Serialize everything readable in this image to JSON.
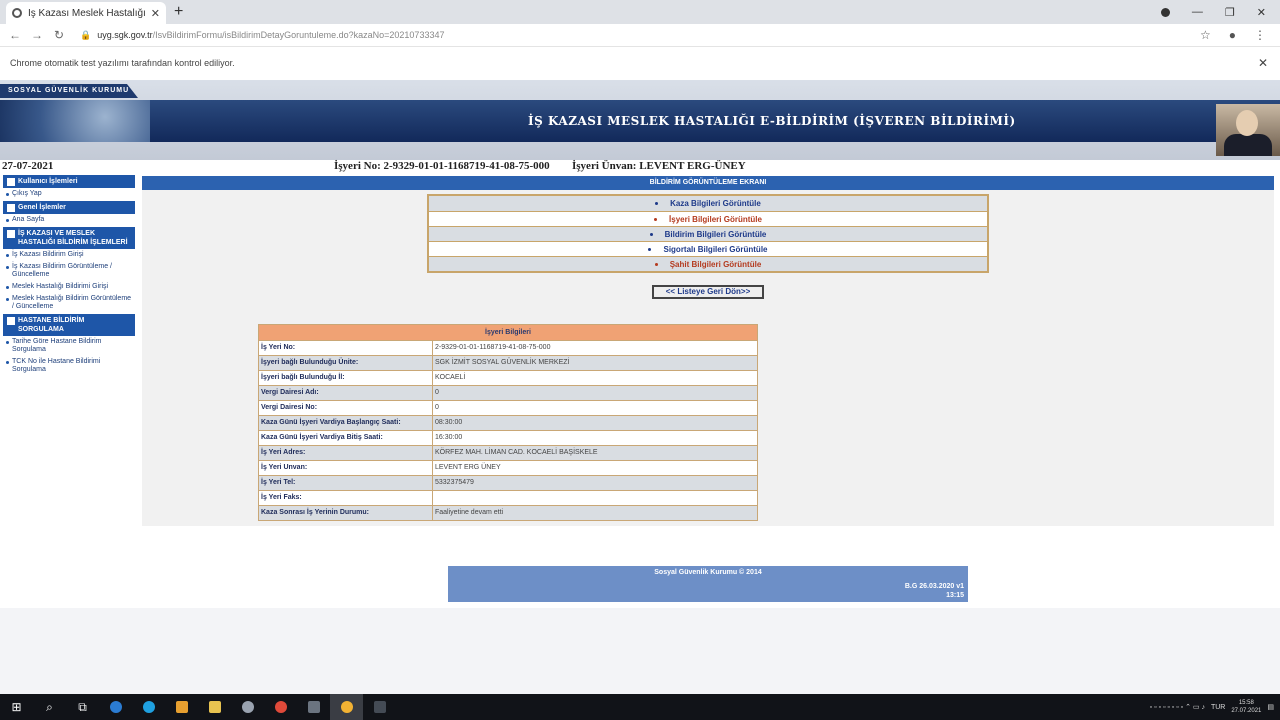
{
  "browser": {
    "tab_title": "İş Kazası Meslek Hastalığı Bildirimi",
    "new_tab": "+",
    "url_host": "uyg.sgk.gov.tr",
    "url_path": "/IsvBildirimFormu/isBildirimDetayGoruntuleme.do?kazaNo=20210733347",
    "infobar_text": "Chrome otomatik test yazılımı tarafından kontrol ediliyor."
  },
  "banner": {
    "logo_text": "SOSYAL GÜVENLİK KURUMU",
    "title": "İŞ KAZASI MESLEK HASTALIĞI E-BİLDİRİM (İŞVEREN BİLDİRİMİ)"
  },
  "info": {
    "date": "27-07-2021",
    "isyeri_no": "İşyeri No: 2-9329-01-01-1168719-41-08-75-000",
    "isyeri_unvan": "İşyeri Ünvan: LEVENT ERG-ÜNEY"
  },
  "sidebar": {
    "sections": [
      {
        "title": "Kullanıcı İşlemleri",
        "items": [
          "Çıkış Yap"
        ]
      },
      {
        "title": "Genel İşlemler",
        "items": [
          "Ana Sayfa"
        ]
      },
      {
        "title": "İŞ KAZASI VE MESLEK HASTALIĞI BİLDİRİM İŞLEMLERİ",
        "items": [
          "İş Kazası Bildirim Girişi",
          "İş Kazası Bildirim Görüntüleme / Güncelleme",
          "Meslek Hastalığı Bildirimi Girişi",
          "Meslek Hastalığı Bildirim Görüntüleme / Güncelleme"
        ]
      },
      {
        "title": "HASTANE BİLDİRİM SORGULAMA",
        "items": [
          "Tarihe Göre Hastane Bildirim Sorgulama",
          "TCK No ile Hastane Bildirimi Sorgulama"
        ]
      }
    ]
  },
  "main": {
    "screen_title": "BİLDİRİM GÖRÜNTÜLEME EKRANI",
    "menu": [
      "Kaza Bilgileri Görüntüle",
      "İşyeri Bilgileri Görüntüle",
      "Bildirim Bilgileri Görüntüle",
      "Sigortalı Bilgileri Görüntüle",
      "Şahit Bilgileri Görüntüle"
    ],
    "back_button": "<< Listeye Geri Dön>>",
    "detail_title": "İşyeri Bilgileri",
    "rows": [
      {
        "label": "İş Yeri No:",
        "value": "2-9329-01-01-1168719-41-08-75-000"
      },
      {
        "label": "İşyeri bağlı Bulunduğu Ünite:",
        "value": "SGK İZMİT SOSYAL GÜVENLİK MERKEZİ"
      },
      {
        "label": "İşyeri bağlı Bulunduğu İl:",
        "value": "KOCAELİ"
      },
      {
        "label": "Vergi Dairesi Adı:",
        "value": "0"
      },
      {
        "label": "Vergi Dairesi No:",
        "value": "0"
      },
      {
        "label": "Kaza Günü İşyeri Vardiya Başlangıç Saati:",
        "value": "08:30:00"
      },
      {
        "label": "Kaza Günü İşyeri Vardiya Bitiş Saati:",
        "value": "16:30:00"
      },
      {
        "label": "İş Yeri Adres:",
        "value": "KÖRFEZ MAH. LİMAN CAD. KOCAELİ BAŞİSKELE"
      },
      {
        "label": "İş Yeri Unvan:",
        "value": "LEVENT ERG ÜNEY"
      },
      {
        "label": "İş Yeri Tel:",
        "value": "5332375479"
      },
      {
        "label": "İş Yeri Faks:",
        "value": ""
      },
      {
        "label": "Kaza Sonrası İş Yerinin Durumu:",
        "value": "Faaliyetine devam etti"
      }
    ]
  },
  "footer": {
    "copyright": "Sosyal Güvenlik Kurumu © 2014",
    "version": "B.G 26.03.2020 v1",
    "time": "13:15"
  },
  "taskbar": {
    "lang": "TUR",
    "clock_time": "15:58",
    "clock_date": "27.07.2021"
  }
}
